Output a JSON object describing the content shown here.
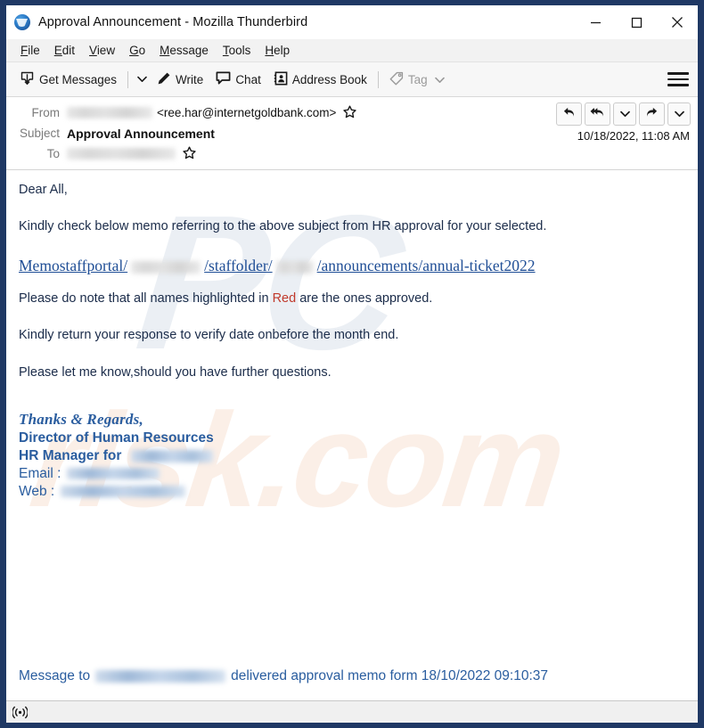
{
  "window": {
    "title": "Approval Announcement - Mozilla Thunderbird",
    "app_icon": "thunderbird-logo-icon",
    "frame_color": "#1f3864",
    "controls": {
      "minimize": "minimize-icon",
      "maximize": "maximize-icon",
      "close": "close-icon"
    }
  },
  "menubar": {
    "items": [
      {
        "label": "File",
        "accesskey": "F"
      },
      {
        "label": "Edit",
        "accesskey": "E"
      },
      {
        "label": "View",
        "accesskey": "V"
      },
      {
        "label": "Go",
        "accesskey": "G"
      },
      {
        "label": "Message",
        "accesskey": "M"
      },
      {
        "label": "Tools",
        "accesskey": "T"
      },
      {
        "label": "Help",
        "accesskey": "H"
      }
    ]
  },
  "toolbar": {
    "get_messages": "Get Messages",
    "get_messages_icon": "download-inbox-icon",
    "get_messages_caret": "chevron-down-icon",
    "write": "Write",
    "write_icon": "pencil-icon",
    "chat": "Chat",
    "chat_icon": "speech-bubble-icon",
    "address_book": "Address Book",
    "address_book_icon": "address-book-icon",
    "tag": "Tag",
    "tag_icon": "tag-icon",
    "tag_caret": "chevron-down-icon",
    "tag_disabled": true,
    "app_menu_icon": "hamburger-menu-icon"
  },
  "message_header": {
    "from_label": "From",
    "from_name_redacted": true,
    "from_address": "<ree.har@internetgoldbank.com>",
    "from_star_icon": "star-icon",
    "subject_label": "Subject",
    "subject": "Approval Announcement",
    "to_label": "To",
    "to_redacted": true,
    "to_star_icon": "star-icon",
    "date": "10/18/2022, 11:08 AM",
    "actions": [
      {
        "name": "reply-button",
        "icon": "reply-arrow-icon"
      },
      {
        "name": "reply-all-button",
        "icon": "reply-all-arrow-icon"
      },
      {
        "name": "reply-more-button",
        "icon": "chevron-down-icon"
      },
      {
        "name": "forward-button",
        "icon": "forward-arrow-icon"
      },
      {
        "name": "more-actions-button",
        "icon": "chevron-down-icon"
      }
    ]
  },
  "body": {
    "greeting": "Dear All,",
    "paragraph_1": "Kindly check below memo referring to the above subject from HR approval for your selected.",
    "link": {
      "part_1": "Memostaffportal/",
      "redacted_1": true,
      "part_2": "/staffolder/",
      "redacted_2": true,
      "part_3": "/announcements/annual-ticket2022"
    },
    "paragraph_2_pre": "Please do note that all names highlighted in ",
    "paragraph_2_red": "Red",
    "paragraph_2_post": " are the ones approved.",
    "red_color": "#c0392b",
    "paragraph_3": "Kindly return your response to verify date onbefore the month end.",
    "paragraph_4": "Please let me know,should you have further questions.",
    "text_color": "#1b2c4a",
    "link_color": "#1f4e96"
  },
  "signature": {
    "thanks": "Thanks & Regards,",
    "title_line": "Director of Human Resources",
    "manager_line": "HR Manager for",
    "manager_company_redacted": true,
    "email_label": "Email :",
    "email_redacted": true,
    "web_label": "Web   :",
    "web_redacted": true,
    "color": "#2a5d9f"
  },
  "footer": {
    "prefix": "Message to",
    "recipient_redacted": true,
    "suffix": "delivered approval memo form 18/10/2022 09:10:37"
  },
  "watermark": {
    "top_text": "PC",
    "bottom_text": "risk.com"
  },
  "statusbar": {
    "icon": "broadcast-signal-icon"
  }
}
